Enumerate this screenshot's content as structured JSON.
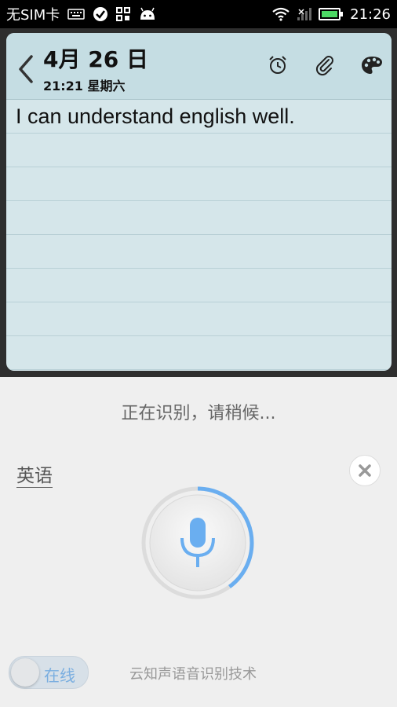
{
  "status_bar": {
    "carrier": "无SIM卡",
    "time": "21:26",
    "icons": [
      "keyboard-icon",
      "check-circle-icon",
      "qr-grid-icon",
      "android-icon",
      "wifi-icon",
      "signal-icon",
      "battery-icon"
    ]
  },
  "note": {
    "date": "4月 26 日",
    "time_weekday": "21:21 星期六",
    "content": "I can understand english well.",
    "header_icons": [
      "alarm-icon",
      "paperclip-icon",
      "palette-icon"
    ]
  },
  "voice": {
    "status_text": "正在识别，请稍候...",
    "language": "英语",
    "online_toggle_label": "在线",
    "credit": "云知声语音识别技术",
    "progress_fraction": 0.4
  },
  "colors": {
    "accent_blue": "#6aaef0",
    "note_bg": "#d5e6ea",
    "panel_bg": "#efefef"
  }
}
